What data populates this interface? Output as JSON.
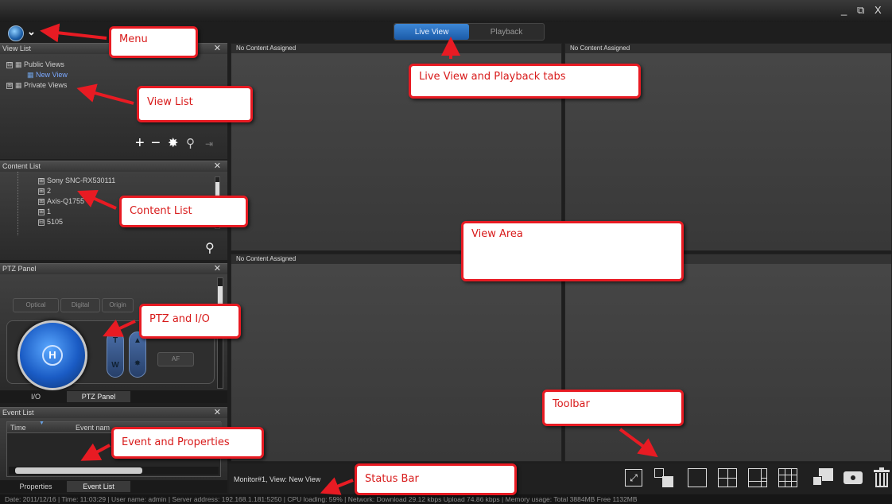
{
  "window": {
    "minimize": "_",
    "restore": "⧉",
    "close": "X"
  },
  "menu": {
    "chevron": "⌄"
  },
  "tabs": [
    {
      "label": "Live View"
    },
    {
      "label": "Playback"
    }
  ],
  "view_list": {
    "title": "View List",
    "close": "✕",
    "items": [
      {
        "label": "Public Views",
        "expander": "⊟"
      },
      {
        "label": "New View"
      },
      {
        "label": "Private Views",
        "expander": "⊞"
      }
    ],
    "tools": {
      "add": "+",
      "remove": "−",
      "settings": "✸",
      "search": "⚲",
      "export": "⇥"
    }
  },
  "content_list": {
    "title": "Content List",
    "close": "✕",
    "items": [
      {
        "label": "Sony SNC-RX530111",
        "expander": "⊞"
      },
      {
        "label": "2",
        "expander": "⊞"
      },
      {
        "label": "Axis-Q1755",
        "expander": "⊞"
      },
      {
        "label": "1",
        "expander": "⊞"
      },
      {
        "label": "5105",
        "expander": "⊟"
      }
    ],
    "search": "⚲"
  },
  "ptz_panel": {
    "title": "PTZ Panel",
    "close": "✕",
    "buttons": [
      "Optical",
      "Digital",
      "Origin"
    ],
    "joystick_label": "H",
    "zoom": {
      "tele": "T",
      "wide": "W"
    },
    "af": "AF",
    "tabs": [
      {
        "label": "I/O"
      },
      {
        "label": "PTZ Panel"
      }
    ]
  },
  "event_list": {
    "title": "Event List",
    "close": "✕",
    "columns": [
      "Time",
      "Event nam"
    ],
    "tabs": [
      {
        "label": "Properties"
      },
      {
        "label": "Event List"
      }
    ]
  },
  "view_area": {
    "panes": [
      {
        "label": "No Content Assigned"
      },
      {
        "label": "No Content Assigned"
      },
      {
        "label": "No Content Assigned"
      }
    ]
  },
  "status_line": "Monitor#1, View: New View",
  "status_bar": "Date: 2011/12/16  |  Time: 11:03:29  |  User name: admin  |  Server address: 192.168.1.181:5250  |  CPU loading: 59%  |  Network: Download    29.12 kbps Upload    74.86 kbps  |  Memory usage: Total 3884MB  Free 1132MB",
  "toolbar": [
    "fullscreen-icon",
    "layout-swap-icon",
    "layout-1x1-icon",
    "layout-2x2-icon",
    "layout-1plus3-icon",
    "layout-3x3-icon",
    "custom-layout-icon",
    "snapshot-icon",
    "trash-icon"
  ],
  "annotations": {
    "menu": "Menu",
    "tabs": "Live View and Playback tabs",
    "view_list": "View List",
    "content_list": "Content List",
    "view_area": "View Area",
    "ptz": "PTZ and I/O",
    "toolbar": "Toolbar",
    "event": "Event and Properties",
    "status": "Status Bar"
  },
  "colors": {
    "accent": "#1b5ba8",
    "annotation_border": "#e81b23",
    "annotation_text": "#d81b1b"
  }
}
